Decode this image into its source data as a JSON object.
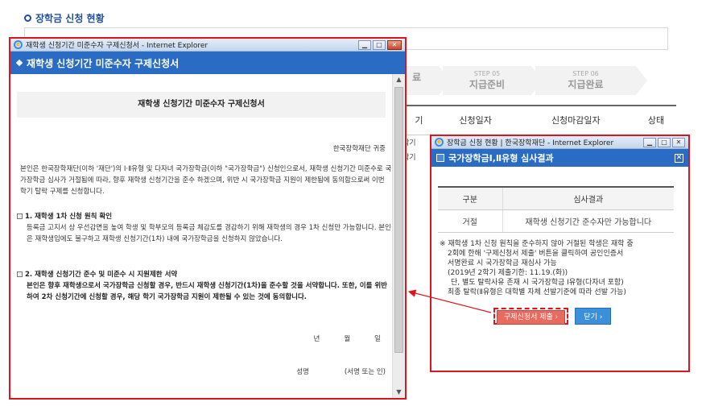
{
  "background": {
    "section_title": "장학금 신청 현황",
    "steps": [
      {
        "num": "",
        "label": "료"
      },
      {
        "num": "STEP 05",
        "label": "지급준비"
      },
      {
        "num": "STEP 06",
        "label": "지급완료"
      }
    ],
    "table_headers": [
      "기",
      "신청일자",
      "신청마감일자",
      "상태"
    ],
    "table_rows": [
      "학기",
      "학기"
    ]
  },
  "win1": {
    "titlebar": "재학생 신청기간 미준수자 구제신청서 - Internet Explorer",
    "header": "재학생 신청기간 미준수자 구제신청서",
    "doc_title": "재학생 신청기간 미준수자 구제신청서",
    "addressee": "한국장학재단 귀중",
    "intro": "본인은 한국장학재단(이하 '재단')의 Ⅰ·Ⅱ유형 및 다자녀 국가장학금(이하 \"국가장학금\") 신청인으로서, 재학생 신청기간 미준수로 국가장학금 심사가 거절됨에 따라, 향후 재학생 신청기간을 준수 하겠으며, 위반 시 국가장학금 지원이 제한됨에 동의함으로써 이번 학기 탈락 구제를 신청합니다.",
    "sec1_title": "1. 재학생 1차 신청 원칙 확인",
    "sec1_text": "등록금 고지서 상 우선감면을 높여 학생 및 학부모의 등록금 체감도를 경감하기 위해 재학생의 경우 1차 신청만 가능합니다. 본인은 재학생임에도 불구하고 재학생 신청기간(1차) 내에 국가장학금을 신청하지 않았습니다.",
    "sec2_title": "2. 재학생 신청기간 준수 및 미준수 시 지원제한 서약",
    "sec2_text": "본인은 향후 재학생으로서 국가장학금 신청할 경우, 반드시 재학생 신청기간(1차)을 준수할 것을 서약합니다. 또한, 이를 위반하여 2차 신청기간에 신청할 경우, 해당 학기 국가장학금 지원이 제한될 수 있는 것에 동의합니다.",
    "date_labels": [
      "년",
      "월",
      "일"
    ],
    "sign_label": "성명",
    "sign_hint": "(서명 또는 인)"
  },
  "win2": {
    "titlebar": "장학금 신청 현황 | 한국장학재단 - Internet Explorer",
    "header": "국가장학금Ⅰ,Ⅱ유형 심사결과",
    "table_headers": [
      "구분",
      "심사결과"
    ],
    "table_row": [
      "거절",
      "재학생 신청기간 준수자만 가능합니다"
    ],
    "note_lines": [
      "※ 재학생 1차 신청 원칙을 준수하지 않아 거절된 학생은 재학 중",
      "2회에 한해 '구제신청서 제출' 버튼을 클릭하여 공인인증서",
      "서명완료 시 국가장학금 재심사 가능",
      "(2019년 2학기 제출기한: 11.19.(화))",
      "단, 별도 탈락사유 존재 시 국가장학금 Ⅰ유형(다자녀 포함)",
      "최종 탈락(Ⅱ유형은 대학별 자체 선발기준에 따라 선발 가능)"
    ],
    "apply_button": "구제신청서 제출",
    "close_button": "닫기"
  },
  "colors": {
    "highlight": "#e0141e",
    "header_blue": "#2a6cc3",
    "apply_red": "#e96a5f",
    "close_blue": "#3c8fd9"
  }
}
